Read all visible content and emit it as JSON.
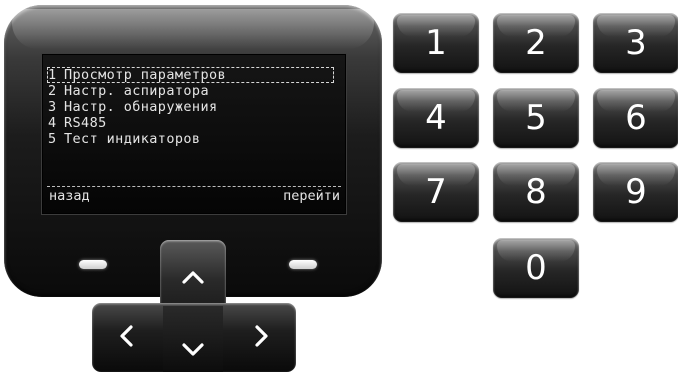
{
  "screen": {
    "menu": [
      {
        "number": "1",
        "label": "Просмотр параметров",
        "selected": true
      },
      {
        "number": "2",
        "label": "Настр. аспиратора",
        "selected": false
      },
      {
        "number": "3",
        "label": "Настр. обнаружения",
        "selected": false
      },
      {
        "number": "4",
        "label": "RS485",
        "selected": false
      },
      {
        "number": "5",
        "label": "Тест индикаторов",
        "selected": false
      }
    ],
    "soft_left": "назад",
    "soft_right": "перейти"
  },
  "dpad": {
    "up_icon": "chevron-up-icon",
    "down_icon": "chevron-down-icon",
    "left_icon": "chevron-left-icon",
    "right_icon": "chevron-right-icon"
  },
  "keypad": {
    "k1": "1",
    "k2": "2",
    "k3": "3",
    "k4": "4",
    "k5": "5",
    "k6": "6",
    "k7": "7",
    "k8": "8",
    "k9": "9",
    "k0": "0"
  },
  "colors": {
    "screen_text": "#e4e4e4",
    "screen_bg": "#0a0a0a",
    "key_label": "#ffffff"
  }
}
